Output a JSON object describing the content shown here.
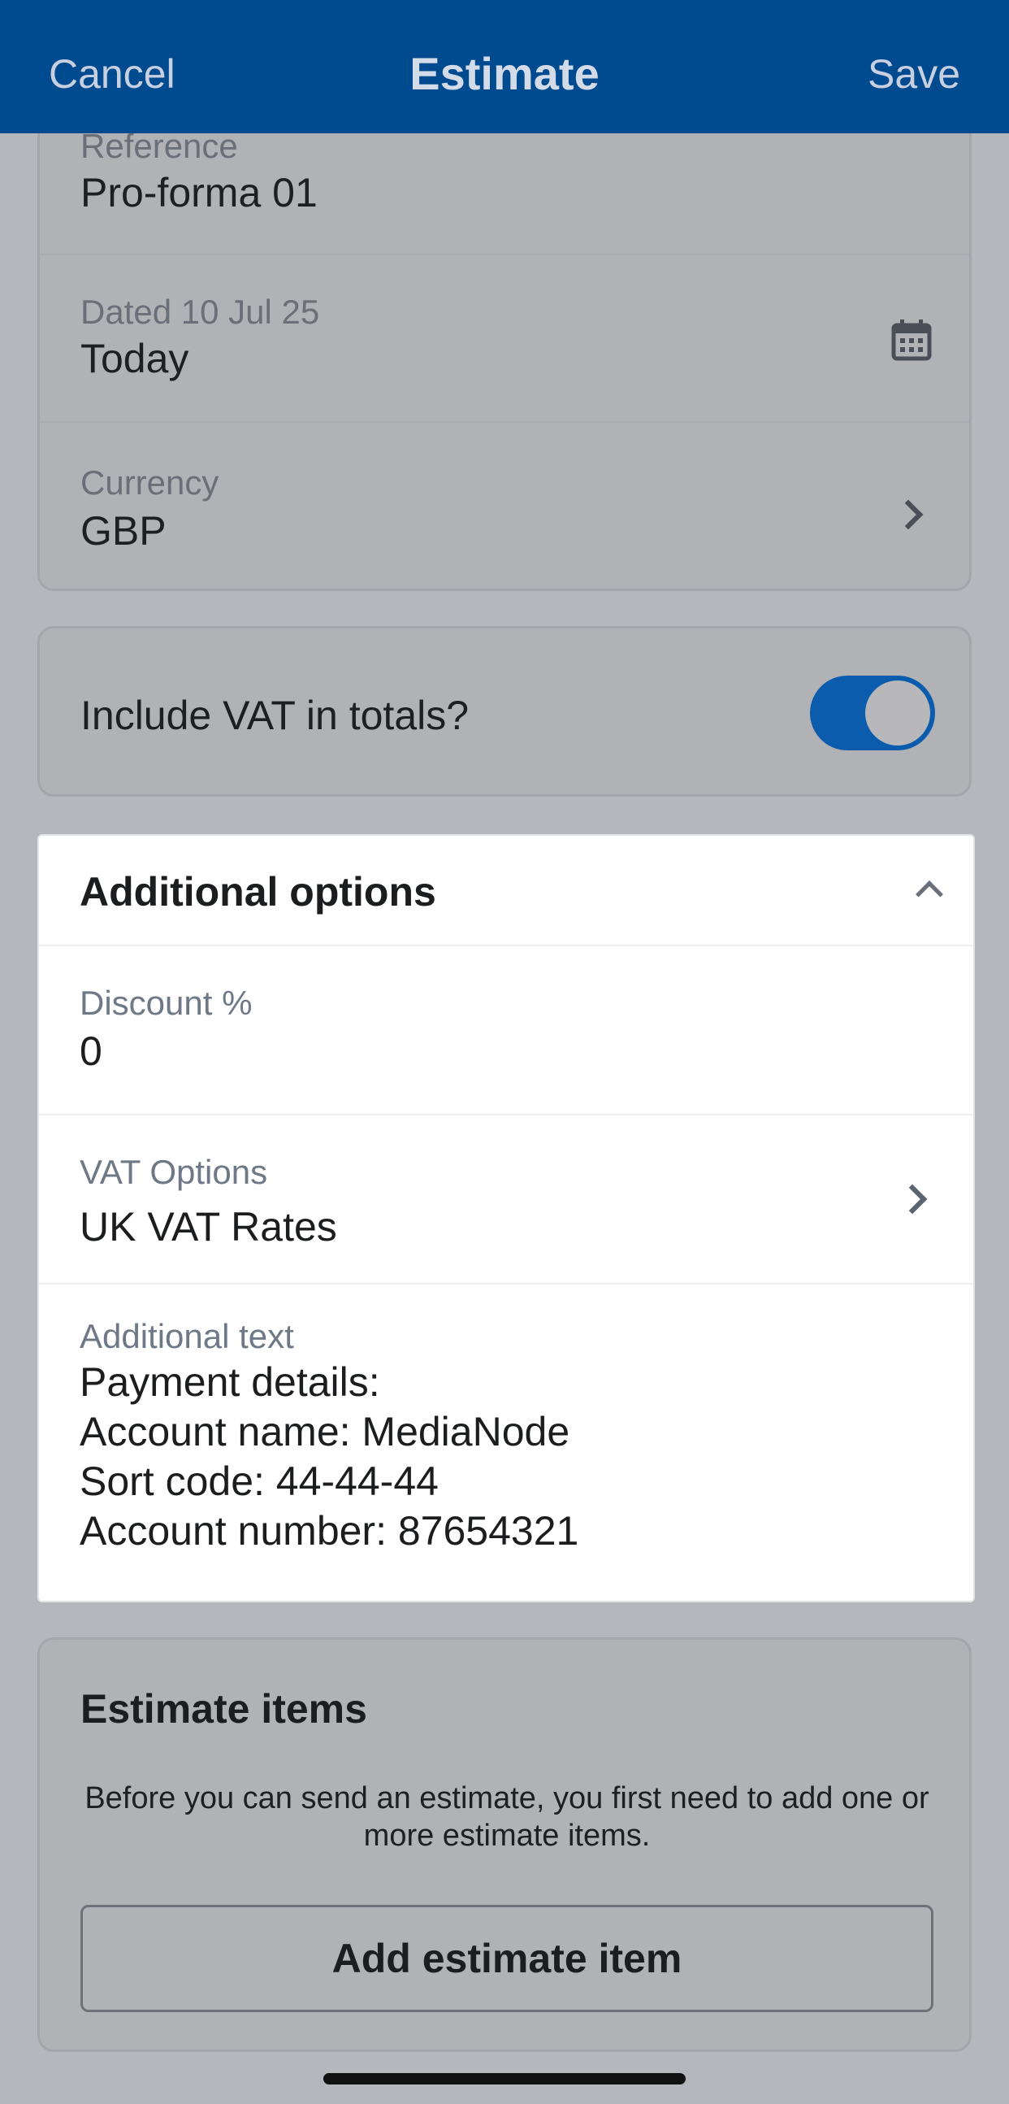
{
  "nav": {
    "cancel": "Cancel",
    "title": "Estimate",
    "save": "Save"
  },
  "details": {
    "reference_label": "Reference",
    "reference_value": "Pro-forma 01",
    "date_label": "Dated 10 Jul 25",
    "date_value": "Today",
    "date_icon": "calendar-icon",
    "currency_label": "Currency",
    "currency_value": "GBP"
  },
  "vat_toggle": {
    "label": "Include VAT in totals?",
    "on": true
  },
  "additional": {
    "title": "Additional options",
    "discount_label": "Discount %",
    "discount_value": "0",
    "vat_options_label": "VAT Options",
    "vat_options_value": "UK VAT Rates",
    "text_label": "Additional text",
    "text_lines": [
      "Payment details:",
      "Account name: MediaNode",
      "Sort code: 44-44-44",
      "Account number: 87654321"
    ]
  },
  "items": {
    "title": "Estimate items",
    "message": "Before you can send an estimate, you first need to add one or more estimate items.",
    "add_button": "Add estimate item"
  },
  "colors": {
    "navbar": "#004b8f",
    "toggle_on": "#0b5cad",
    "dim_background": "#b6b7bc"
  }
}
